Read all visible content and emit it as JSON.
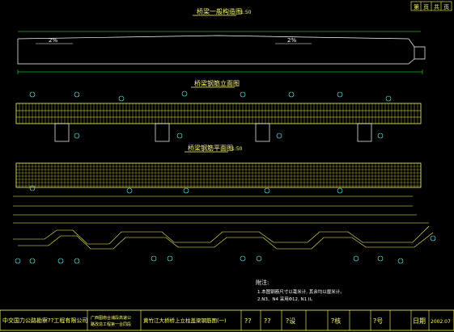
{
  "drawing": {
    "header_boxes": [
      "第",
      "页",
      "共",
      "页"
    ],
    "section1": {
      "title": "桥梁一般构造图",
      "scale": "1:50"
    },
    "section2": {
      "title": "桥梁钢筋立面图",
      "scale": ""
    },
    "section3": {
      "title": "桥梁钢筋平面图",
      "scale": "1:50"
    },
    "slope_left": "2%",
    "slope_right": "2%",
    "notes_title": "附注:",
    "note_1": "1.本图钢筋尺寸以毫米计, 其余均以厘米计。",
    "note_2": "2.N3、N4 采用Φ12, N1 II。"
  },
  "title_block": {
    "company": "中交国力公路勘察??工程有限公司",
    "project_line1": "广西图南合浦段高速公",
    "project_line2": "路改造工程第一合同段",
    "drawing_name": "黄竹江大桥桥上立柱盖梁钢筋图(一)",
    "cell_q1": "??",
    "cell_q2": "??",
    "design_label": "?设",
    "review_label": "?核",
    "approve_label": "?核",
    "number_label": "?号",
    "date_label": "日期",
    "date_value": "2002.07"
  },
  "colors": {
    "background": "#000000",
    "title_yellow": "#ffff66",
    "line_white": "#ffffff",
    "dim_green": "#33ff33",
    "label_cyan": "#66ffff"
  }
}
